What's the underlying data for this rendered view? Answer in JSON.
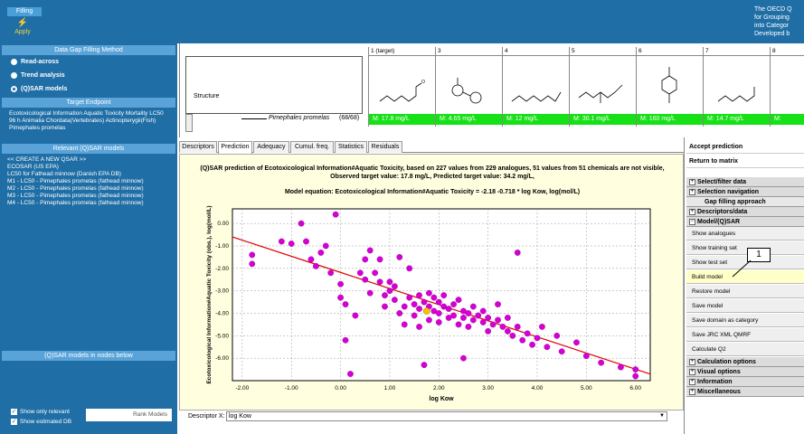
{
  "topbar": {
    "filling_tab": "Filling",
    "apply_label": "Apply",
    "oecd_lines": [
      "The OECD Q",
      "for Grouping",
      "into Categor",
      "Developed b"
    ]
  },
  "left": {
    "gap_method_head": "Data Gap Filling Method",
    "methods": [
      "Read-across",
      "Trend analysis",
      "(Q)SAR models"
    ],
    "selected_method": "(Q)SAR models",
    "target_head": "Target Endpoint",
    "target_text": "Ecotoxicological Information Aquatic Toxicity Mortality LC50 96 h Animalia Chordata(Vertebrates) Actinopterygii(Fish) Pimephales promelas",
    "relevant_head": "Relevant (Q)SAR models",
    "models": [
      "<< CREATE A NEW QSAR >>",
      "ECOSAR (US EPA)",
      "LC50 for Fathead minnow (Danish EPA DB)",
      "M1 - LC50 - Pimephales promelas (fathead minnow)",
      "M2 - LC50 - Pimephales promelas (fathead minnow)",
      "M3 - LC50 - Pimephales promelas (fathead minnow)",
      "M4 - LC50 - Pimephales promelas (fathead minnow)"
    ],
    "nodes_head": "(Q)SAR models in nodes below",
    "show_only_relevant": "Show only relevant",
    "show_estimated": "Show estimated DB",
    "rank_models": "Rank Models"
  },
  "grid": {
    "structure_label": "Structure",
    "endpoint_name": "Pimephales promelas",
    "endpoint_count": "(68/68)",
    "columns": [
      {
        "head": "1 (target)",
        "value": "M: 17.8 mg/L"
      },
      {
        "head": "3",
        "value": "M: 4.65 mg/L"
      },
      {
        "head": "4",
        "value": "M: 12 mg/L"
      },
      {
        "head": "5",
        "value": "M: 30.1 mg/L"
      },
      {
        "head": "6",
        "value": "M: 160 mg/L"
      },
      {
        "head": "7",
        "value": "M: 14.7 mg/L"
      },
      {
        "head": "8",
        "value": "M:"
      }
    ]
  },
  "tabs": [
    "Descriptors",
    "Prediction",
    "Adequacy",
    "Cumul. freq.",
    "Statistics",
    "Residuals"
  ],
  "active_tab": "Prediction",
  "chart": {
    "title_line1": "(Q)SAR prediction of Ecotoxicological Information#Aquatic Toxicity, based on 227 values from 229 analogues, 51 values from 51 chemicals are not visible,",
    "title_line2": "Observed target value: 17.8 mg/L, Predicted target value: 34.2 mg/L,",
    "equation": "Model equation:  Ecotoxicological Information#Aquatic Toxicity = -2.18 -0.718 * log Kow,  log(mol/L)"
  },
  "chart_data": {
    "type": "scatter",
    "xlabel": "log Kow",
    "ylabel": "Ecotoxicological Information#Aquatic Toxicity (obs.), log(mol/L)",
    "xlim": [
      -2.2,
      6.3
    ],
    "ylim": [
      -7.0,
      0.65
    ],
    "xticks": [
      "-2.00",
      "-1.00",
      "0.00",
      "1.00",
      "2.00",
      "3.00",
      "4.00",
      "5.00",
      "6.00"
    ],
    "yticks": [
      "0.00",
      "-1.00",
      "-2.00",
      "-3.00",
      "-4.00",
      "-5.00",
      "-6.00"
    ],
    "grid": true,
    "regression": {
      "intercept": -2.18,
      "slope": -0.718,
      "color": "#e00000"
    },
    "point_color": "#d400d4",
    "target_color": "#f5c400",
    "target_point": {
      "x": 1.75,
      "y": -3.9
    },
    "points": [
      {
        "x": -1.8,
        "y": -1.4
      },
      {
        "x": -1.8,
        "y": -1.8
      },
      {
        "x": -1.2,
        "y": -0.8
      },
      {
        "x": -1.0,
        "y": -0.9
      },
      {
        "x": -0.8,
        "y": 0.0
      },
      {
        "x": -0.7,
        "y": -0.8
      },
      {
        "x": -0.6,
        "y": -1.6
      },
      {
        "x": -0.5,
        "y": -1.9
      },
      {
        "x": -0.4,
        "y": -1.3
      },
      {
        "x": -0.3,
        "y": -1.0
      },
      {
        "x": -0.2,
        "y": -2.2
      },
      {
        "x": -0.1,
        "y": 0.4
      },
      {
        "x": 0.0,
        "y": -2.7
      },
      {
        "x": 0.0,
        "y": -3.3
      },
      {
        "x": 0.1,
        "y": -3.6
      },
      {
        "x": 0.1,
        "y": -5.2
      },
      {
        "x": 0.2,
        "y": -6.7
      },
      {
        "x": 0.3,
        "y": -4.1
      },
      {
        "x": 0.4,
        "y": -2.2
      },
      {
        "x": 0.5,
        "y": -1.6
      },
      {
        "x": 0.5,
        "y": -2.5
      },
      {
        "x": 0.6,
        "y": -3.1
      },
      {
        "x": 0.6,
        "y": -1.2
      },
      {
        "x": 0.7,
        "y": -2.2
      },
      {
        "x": 0.8,
        "y": -1.6
      },
      {
        "x": 0.8,
        "y": -2.6
      },
      {
        "x": 0.9,
        "y": -3.2
      },
      {
        "x": 0.9,
        "y": -3.7
      },
      {
        "x": 1.0,
        "y": -2.6
      },
      {
        "x": 1.0,
        "y": -3.0
      },
      {
        "x": 1.1,
        "y": -2.8
      },
      {
        "x": 1.1,
        "y": -3.4
      },
      {
        "x": 1.2,
        "y": -4.0
      },
      {
        "x": 1.2,
        "y": -1.5
      },
      {
        "x": 1.3,
        "y": -3.7
      },
      {
        "x": 1.3,
        "y": -4.5
      },
      {
        "x": 1.4,
        "y": -3.3
      },
      {
        "x": 1.4,
        "y": -2.0
      },
      {
        "x": 1.5,
        "y": -3.6
      },
      {
        "x": 1.5,
        "y": -4.1
      },
      {
        "x": 1.6,
        "y": -3.2
      },
      {
        "x": 1.6,
        "y": -3.8
      },
      {
        "x": 1.6,
        "y": -4.6
      },
      {
        "x": 1.7,
        "y": -3.5
      },
      {
        "x": 1.8,
        "y": -3.1
      },
      {
        "x": 1.8,
        "y": -3.7
      },
      {
        "x": 1.8,
        "y": -4.3
      },
      {
        "x": 1.9,
        "y": -3.3
      },
      {
        "x": 1.9,
        "y": -3.9
      },
      {
        "x": 2.0,
        "y": -3.5
      },
      {
        "x": 2.0,
        "y": -4.0
      },
      {
        "x": 2.0,
        "y": -4.4
      },
      {
        "x": 2.1,
        "y": -3.2
      },
      {
        "x": 2.1,
        "y": -3.7
      },
      {
        "x": 2.2,
        "y": -3.8
      },
      {
        "x": 2.2,
        "y": -4.2
      },
      {
        "x": 2.3,
        "y": -3.6
      },
      {
        "x": 2.3,
        "y": -4.1
      },
      {
        "x": 2.4,
        "y": -3.4
      },
      {
        "x": 2.4,
        "y": -4.5
      },
      {
        "x": 2.5,
        "y": -3.9
      },
      {
        "x": 2.5,
        "y": -4.2
      },
      {
        "x": 2.6,
        "y": -4.0
      },
      {
        "x": 2.6,
        "y": -4.6
      },
      {
        "x": 2.7,
        "y": -3.7
      },
      {
        "x": 2.7,
        "y": -4.3
      },
      {
        "x": 2.8,
        "y": -4.1
      },
      {
        "x": 2.9,
        "y": -4.4
      },
      {
        "x": 2.9,
        "y": -3.9
      },
      {
        "x": 3.0,
        "y": -4.2
      },
      {
        "x": 3.0,
        "y": -4.8
      },
      {
        "x": 3.1,
        "y": -4.5
      },
      {
        "x": 3.2,
        "y": -4.3
      },
      {
        "x": 3.2,
        "y": -3.6
      },
      {
        "x": 3.3,
        "y": -4.6
      },
      {
        "x": 3.4,
        "y": -4.8
      },
      {
        "x": 3.4,
        "y": -4.2
      },
      {
        "x": 3.5,
        "y": -5.0
      },
      {
        "x": 3.6,
        "y": -4.6
      },
      {
        "x": 3.7,
        "y": -5.2
      },
      {
        "x": 3.8,
        "y": -4.9
      },
      {
        "x": 3.9,
        "y": -5.4
      },
      {
        "x": 4.0,
        "y": -5.1
      },
      {
        "x": 4.1,
        "y": -4.6
      },
      {
        "x": 4.2,
        "y": -5.5
      },
      {
        "x": 4.4,
        "y": -5.0
      },
      {
        "x": 4.5,
        "y": -5.7
      },
      {
        "x": 4.8,
        "y": -5.3
      },
      {
        "x": 5.0,
        "y": -5.9
      },
      {
        "x": 5.3,
        "y": -6.2
      },
      {
        "x": 5.7,
        "y": -6.4
      },
      {
        "x": 6.0,
        "y": -6.5
      },
      {
        "x": 6.0,
        "y": -6.8
      },
      {
        "x": 2.5,
        "y": -6.0
      },
      {
        "x": 3.6,
        "y": -1.3
      },
      {
        "x": 1.7,
        "y": -6.3
      }
    ]
  },
  "descriptor": {
    "label": "Descriptor X:",
    "value": "log Kow"
  },
  "right": {
    "accept": "Accept prediction",
    "return": "Return to matrix",
    "menu": [
      {
        "kind": "head",
        "label": "Select/filter data"
      },
      {
        "kind": "head",
        "label": "Selection navigation"
      },
      {
        "kind": "sub",
        "label": "Gap filling approach"
      },
      {
        "kind": "head",
        "label": "Descriptors/data"
      },
      {
        "kind": "head",
        "label": "Model/(Q)SAR"
      },
      {
        "kind": "item",
        "label": "Show analogues"
      },
      {
        "kind": "item",
        "label": "Show training set"
      },
      {
        "kind": "item",
        "label": "Show test set"
      },
      {
        "kind": "item",
        "label": "Build model",
        "highlight": true
      },
      {
        "kind": "item",
        "label": "Restore model"
      },
      {
        "kind": "item",
        "label": "Save model"
      },
      {
        "kind": "item",
        "label": "Save domain as category"
      },
      {
        "kind": "item",
        "label": "Save JRC XML QMRF"
      },
      {
        "kind": "item",
        "label": "Calculate Q2"
      },
      {
        "kind": "head",
        "label": "Calculation options"
      },
      {
        "kind": "head",
        "label": "Visual options"
      },
      {
        "kind": "head",
        "label": "Information"
      },
      {
        "kind": "head",
        "label": "Miscellaneous"
      }
    ],
    "callout": "1"
  }
}
